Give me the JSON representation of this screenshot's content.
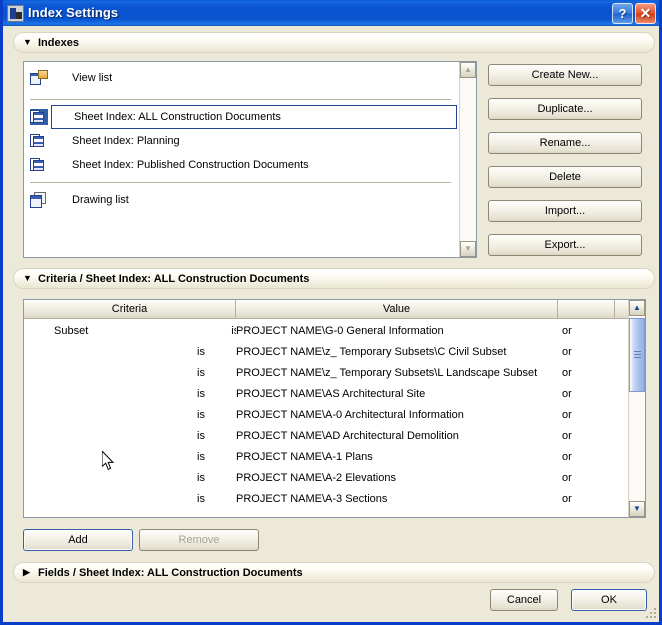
{
  "window": {
    "title": "Index Settings",
    "icon": "app-icon",
    "help_label": "?",
    "close_label": "✕",
    "accent_title_bar": "#0a51cf",
    "dialog_background": "#ece9d8",
    "selection_blue": "#2f5fa8"
  },
  "sections": {
    "indexes": {
      "label": "Indexes",
      "arrow": "▼",
      "expanded": true
    },
    "criteria": {
      "label": "Criteria / Sheet Index:  ALL Construction Documents",
      "arrow": "▼",
      "expanded": true
    },
    "fields": {
      "label": "Fields / Sheet Index:  ALL Construction Documents",
      "arrow": "▶",
      "expanded": false
    }
  },
  "indexes_list": {
    "items": [
      {
        "label": "View list",
        "icon": "view-list-icon",
        "selected": false
      },
      {
        "label": "Sheet Index:  ALL Construction Documents",
        "icon": "sheet-index-icon",
        "selected": true
      },
      {
        "label": "Sheet Index:  Planning",
        "icon": "sheet-index-icon",
        "selected": false
      },
      {
        "label": "Sheet Index:  Published Construction Documents",
        "icon": "sheet-index-icon",
        "selected": false
      },
      {
        "label": "Drawing list",
        "icon": "drawing-list-icon",
        "selected": false
      }
    ],
    "scrollbar": {
      "up_arrow": "▲",
      "down_arrow": "▼",
      "enabled": false
    }
  },
  "side_buttons": [
    {
      "label": "Create New...",
      "name": "create-new-button",
      "disabled": false
    },
    {
      "label": "Duplicate...",
      "name": "duplicate-button",
      "disabled": false
    },
    {
      "label": "Rename...",
      "name": "rename-button",
      "disabled": false
    },
    {
      "label": "Delete",
      "name": "delete-button",
      "disabled": false
    },
    {
      "label": "Import...",
      "name": "import-button",
      "disabled": false
    },
    {
      "label": "Export...",
      "name": "export-button",
      "disabled": false
    }
  ],
  "criteria_table": {
    "columns": [
      "Criteria",
      "Value",
      "",
      ""
    ],
    "rows": [
      {
        "criteria": "Subset",
        "operator": "is",
        "value": "PROJECT NAME\\G-0 General Information",
        "conjunction": "or"
      },
      {
        "criteria": "",
        "operator": "is",
        "value": "PROJECT NAME\\z_ Temporary Subsets\\C Civil Subset",
        "conjunction": "or"
      },
      {
        "criteria": "",
        "operator": "is",
        "value": "PROJECT NAME\\z_ Temporary Subsets\\L Landscape Subset",
        "conjunction": "or"
      },
      {
        "criteria": "",
        "operator": "is",
        "value": "PROJECT NAME\\AS Architectural Site",
        "conjunction": "or"
      },
      {
        "criteria": "",
        "operator": "is",
        "value": "PROJECT NAME\\A-0 Architectural Information",
        "conjunction": "or"
      },
      {
        "criteria": "",
        "operator": "is",
        "value": "PROJECT NAME\\AD Architectural Demolition",
        "conjunction": "or"
      },
      {
        "criteria": "",
        "operator": "is",
        "value": "PROJECT NAME\\A-1 Plans",
        "conjunction": "or"
      },
      {
        "criteria": "",
        "operator": "is",
        "value": "PROJECT NAME\\A-2 Elevations",
        "conjunction": "or"
      },
      {
        "criteria": "",
        "operator": "is",
        "value": "PROJECT NAME\\A-3 Sections",
        "conjunction": "or"
      }
    ],
    "scrollbar": {
      "up_arrow": "▲",
      "down_arrow": "▼",
      "enabled": true
    }
  },
  "bottom_buttons": {
    "add": {
      "label": "Add",
      "disabled": false
    },
    "remove": {
      "label": "Remove",
      "disabled": true
    },
    "cancel": {
      "label": "Cancel",
      "disabled": false
    },
    "ok": {
      "label": "OK",
      "disabled": false,
      "is_default": true
    }
  }
}
